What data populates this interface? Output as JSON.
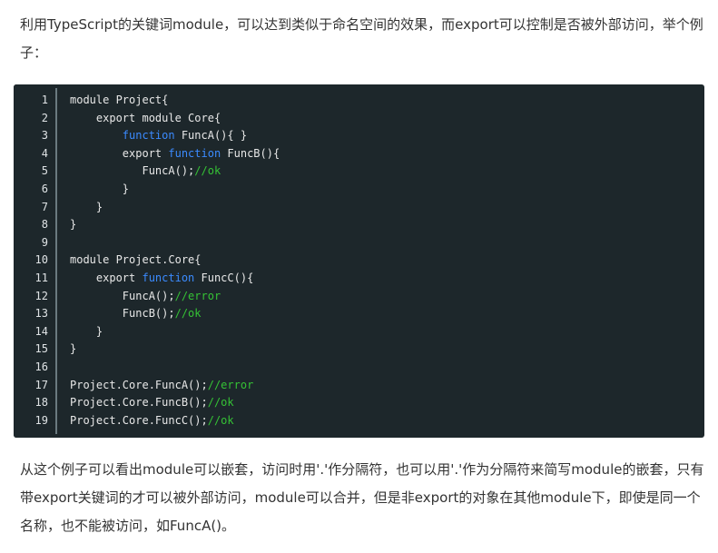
{
  "intro_paragraph": "利用TypeScript的关键词module，可以达到类似于命名空间的效果，而export可以控制是否被外部访问，举个例子：",
  "code": {
    "line_numbers": [
      "1",
      "2",
      "3",
      "4",
      "5",
      "6",
      "7",
      "8",
      "9",
      "10",
      "11",
      "12",
      "13",
      "14",
      "15",
      "16",
      "17",
      "18",
      "19"
    ],
    "lines": [
      [
        {
          "t": "plain",
          "v": "module Project{"
        }
      ],
      [
        {
          "t": "plain",
          "v": "    export module Core{"
        }
      ],
      [
        {
          "t": "plain",
          "v": "        "
        },
        {
          "t": "kw",
          "v": "function"
        },
        {
          "t": "plain",
          "v": " FuncA(){ }"
        }
      ],
      [
        {
          "t": "plain",
          "v": "        export "
        },
        {
          "t": "kw",
          "v": "function"
        },
        {
          "t": "plain",
          "v": " FuncB(){"
        }
      ],
      [
        {
          "t": "plain",
          "v": "           FuncA();"
        },
        {
          "t": "comment",
          "v": "//ok"
        }
      ],
      [
        {
          "t": "plain",
          "v": "        }"
        }
      ],
      [
        {
          "t": "plain",
          "v": "    }"
        }
      ],
      [
        {
          "t": "plain",
          "v": "}"
        }
      ],
      [
        {
          "t": "plain",
          "v": ""
        }
      ],
      [
        {
          "t": "plain",
          "v": "module Project.Core{"
        }
      ],
      [
        {
          "t": "plain",
          "v": "    export "
        },
        {
          "t": "kw",
          "v": "function"
        },
        {
          "t": "plain",
          "v": " FuncC(){"
        }
      ],
      [
        {
          "t": "plain",
          "v": "        FuncA();"
        },
        {
          "t": "comment",
          "v": "//error"
        }
      ],
      [
        {
          "t": "plain",
          "v": "        FuncB();"
        },
        {
          "t": "comment",
          "v": "//ok"
        }
      ],
      [
        {
          "t": "plain",
          "v": "    }"
        }
      ],
      [
        {
          "t": "plain",
          "v": "}"
        }
      ],
      [
        {
          "t": "plain",
          "v": ""
        }
      ],
      [
        {
          "t": "plain",
          "v": "Project.Core.FuncA();"
        },
        {
          "t": "comment",
          "v": "//error"
        }
      ],
      [
        {
          "t": "plain",
          "v": "Project.Core.FuncB();"
        },
        {
          "t": "comment",
          "v": "//ok"
        }
      ],
      [
        {
          "t": "plain",
          "v": "Project.Core.FuncC();"
        },
        {
          "t": "comment",
          "v": "//ok"
        }
      ]
    ],
    "colors": {
      "background": "#1d272b",
      "keyword": "#3b8bff",
      "comment": "#35c235",
      "text": "#e8e8e8"
    }
  },
  "outro_paragraph": "从这个例子可以看出module可以嵌套，访问时用'.'作分隔符，也可以用'.'作为分隔符来简写module的嵌套，只有带export关键词的才可以被外部访问，module可以合并，但是非export的对象在其他module下，即使是同一个名称，也不能被访问，如FuncA()。"
}
